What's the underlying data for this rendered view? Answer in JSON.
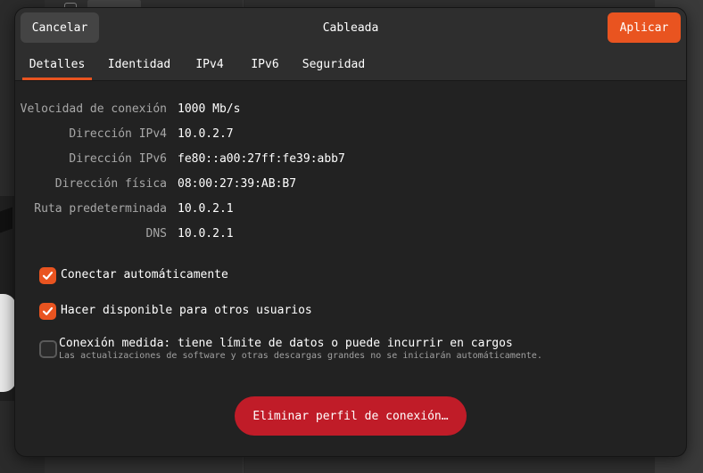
{
  "dialog": {
    "title": "Cableada",
    "cancel_label": "Cancelar",
    "apply_label": "Aplicar"
  },
  "tabs": [
    {
      "label": "Detalles",
      "active": true
    },
    {
      "label": "Identidad",
      "active": false
    },
    {
      "label": "IPv4",
      "active": false
    },
    {
      "label": "IPv6",
      "active": false
    },
    {
      "label": "Seguridad",
      "active": false
    }
  ],
  "details": [
    {
      "label": "Velocidad de conexión",
      "value": "1000 Mb/s"
    },
    {
      "label": "Dirección IPv4",
      "value": "10.0.2.7"
    },
    {
      "label": "Dirección IPv6",
      "value": "fe80::a00:27ff:fe39:abb7"
    },
    {
      "label": "Dirección física",
      "value": "08:00:27:39:AB:B7"
    },
    {
      "label": "Ruta predeterminada",
      "value": "10.0.2.1"
    },
    {
      "label": "DNS",
      "value": "10.0.2.1"
    }
  ],
  "options": {
    "auto_connect": {
      "label": "Conectar automáticamente",
      "checked": true
    },
    "available_all_users": {
      "label": "Hacer disponible para otros usuarios",
      "checked": true
    },
    "metered": {
      "label": "Conexión medida: tiene límite de datos o puede incurrir en cargos",
      "sublabel": "Las actualizaciones de software y otras descargas grandes no se iniciarán automáticamente.",
      "checked": false
    }
  },
  "delete_label": "Eliminar perfil de conexión…",
  "colors": {
    "accent": "#e95420",
    "destructive": "#c01c28",
    "dialog_bg": "#222222",
    "header_bg": "#2e2e2e"
  }
}
